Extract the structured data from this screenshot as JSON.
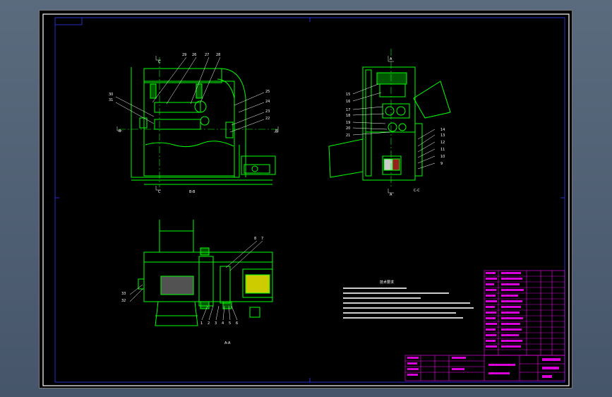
{
  "colors": {
    "background": "#000000",
    "frame": "#ffffff",
    "border_line": "#2f3bff",
    "geometry": "#00ff00",
    "section_marks": "#ffffff",
    "callouts": "#ffffff",
    "title_block": "#ff00ff",
    "highlight": "#ffff00"
  },
  "views": {
    "bb_label": "B-B",
    "cc_label": "C-C",
    "aa_label": "A-A"
  },
  "section_marks": {
    "c": "C",
    "b": "B",
    "a": "A"
  },
  "callouts": {
    "v1_top": [
      "29",
      "26",
      "27",
      "28"
    ],
    "v1_left": [
      "30",
      "31"
    ],
    "v1_right": [
      "25",
      "24",
      "23",
      "22"
    ],
    "v2_left": [
      "15",
      "16",
      "17",
      "18",
      "19",
      "20",
      "21"
    ],
    "v2_right": [
      "14",
      "13",
      "12",
      "11",
      "10",
      "9"
    ],
    "v3_top": [
      "8",
      "7"
    ],
    "v3_left": [
      "33",
      "32"
    ],
    "v3_bottom": [
      "1",
      "2",
      "3",
      "4",
      "5",
      "6"
    ]
  },
  "notes": {
    "title": "技术要求"
  }
}
